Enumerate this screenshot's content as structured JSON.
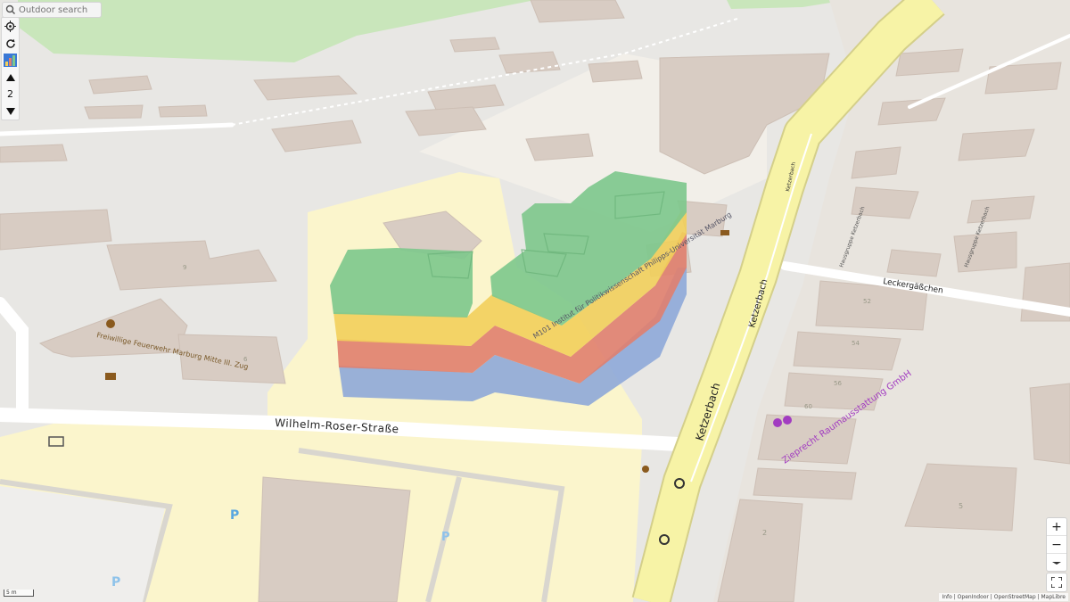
{
  "search": {
    "placeholder": "Outdoor search"
  },
  "left_tools": {
    "level": "2"
  },
  "streets": {
    "wilhelm_roser": "Wilhelm-Roser-Straße",
    "ketzerbach_main": "Ketzerbach",
    "ketzerbach_mid": "Ketzerbach",
    "ketzerbach_top": "Ketzerbach",
    "leckergasschen": "Leckergäßchen"
  },
  "pois": {
    "fire_station": "Freiwillige Feuerwehr Marburg Mitte III. Zug",
    "institute": "M101 Institut für Politikwissenschaft Philipps-Universität Marburg",
    "shop": "Zieprecht Raumausstattung GmbH",
    "hausgruppe_1": "Hausgruppe Ketzerbach",
    "hausgruppe_2": "Hausgruppe Ketzerbach"
  },
  "house_numbers": [
    "6",
    "9",
    "52",
    "54",
    "56",
    "60",
    "5",
    "2"
  ],
  "scale_bar": {
    "label": "5 m"
  },
  "attribution": "Info | OpenIndoor | OpenStreetMap | MapLibre",
  "colors": {
    "level_green": "#7fc88d",
    "level_yellow": "#f2cf5b",
    "level_red": "#e0806e",
    "level_blue": "#8ea9d8",
    "road_yellow": "#f7f3a6",
    "park_green": "#c9e6bb",
    "building": "#d8ccc3",
    "poi_purple": "#a23cc1"
  }
}
